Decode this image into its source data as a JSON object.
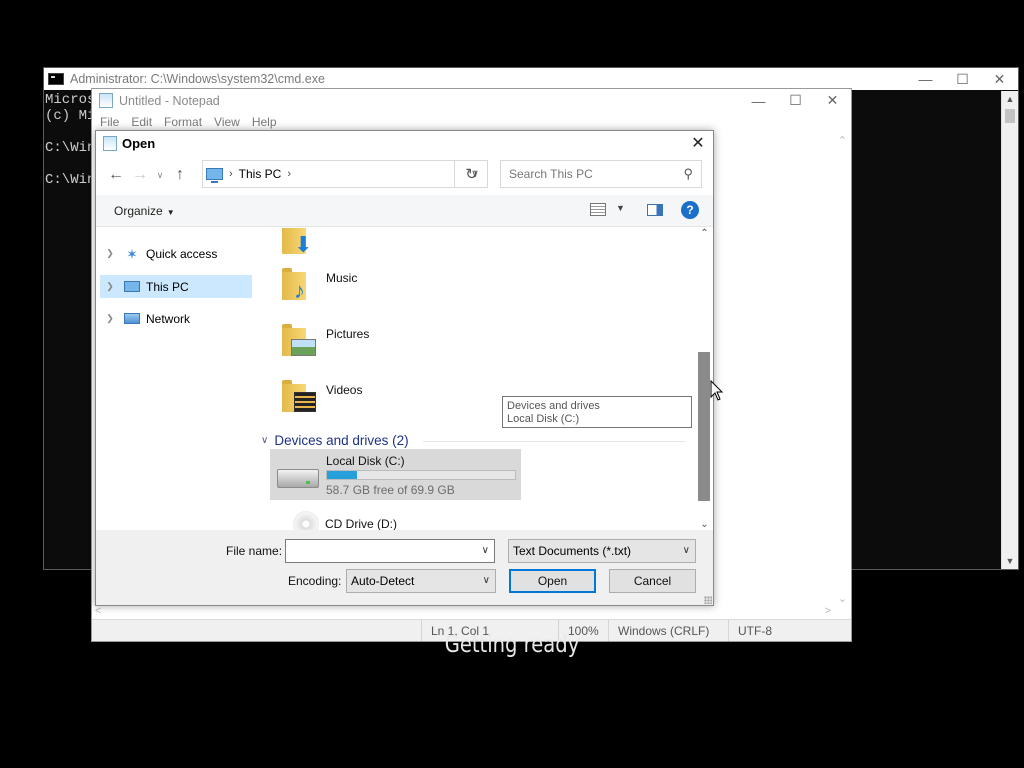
{
  "cmd": {
    "title": "Administrator: C:\\Windows\\system32\\cmd.exe",
    "lines": [
      "Micros",
      "(c) Mi",
      "",
      "C:\\Win",
      "",
      "C:\\Win"
    ]
  },
  "notepad": {
    "title": "Untitled - Notepad",
    "menu": [
      "File",
      "Edit",
      "Format",
      "View",
      "Help"
    ],
    "status": {
      "position": "Ln 1, Col 1",
      "zoom": "100%",
      "line_endings": "Windows (CRLF)",
      "encoding": "UTF-8"
    }
  },
  "dialog": {
    "title": "Open",
    "address": "This PC",
    "search_placeholder": "Search This PC",
    "organize": "Organize",
    "nav": [
      {
        "label": "Quick access",
        "icon": "star-icon"
      },
      {
        "label": "This PC",
        "icon": "computer-icon",
        "selected": true
      },
      {
        "label": "Network",
        "icon": "network-icon"
      }
    ],
    "folders": [
      {
        "label": "Music",
        "icon": "music-folder-icon"
      },
      {
        "label": "Pictures",
        "icon": "pictures-folder-icon"
      },
      {
        "label": "Videos",
        "icon": "videos-folder-icon"
      }
    ],
    "group": "Devices and drives (2)",
    "drives": [
      {
        "label": "Local Disk (C:)",
        "free": "58.7 GB free of 69.9 GB",
        "used_fraction": 0.16
      },
      {
        "label": "CD Drive (D:)"
      }
    ],
    "tooltip": [
      "Devices and drives",
      "Local Disk (C:)"
    ],
    "file_name_label": "File name:",
    "file_name_value": "",
    "file_type": "Text Documents (*.txt)",
    "encoding_label": "Encoding:",
    "encoding_value": "Auto-Detect",
    "open_label": "Open",
    "cancel_label": "Cancel"
  },
  "subtitle": "Getting ready",
  "colors": {
    "selection": "#cce8ff",
    "accent": "#0078d7",
    "drive_bar": "#26a0da",
    "group_header": "#1e3287"
  }
}
